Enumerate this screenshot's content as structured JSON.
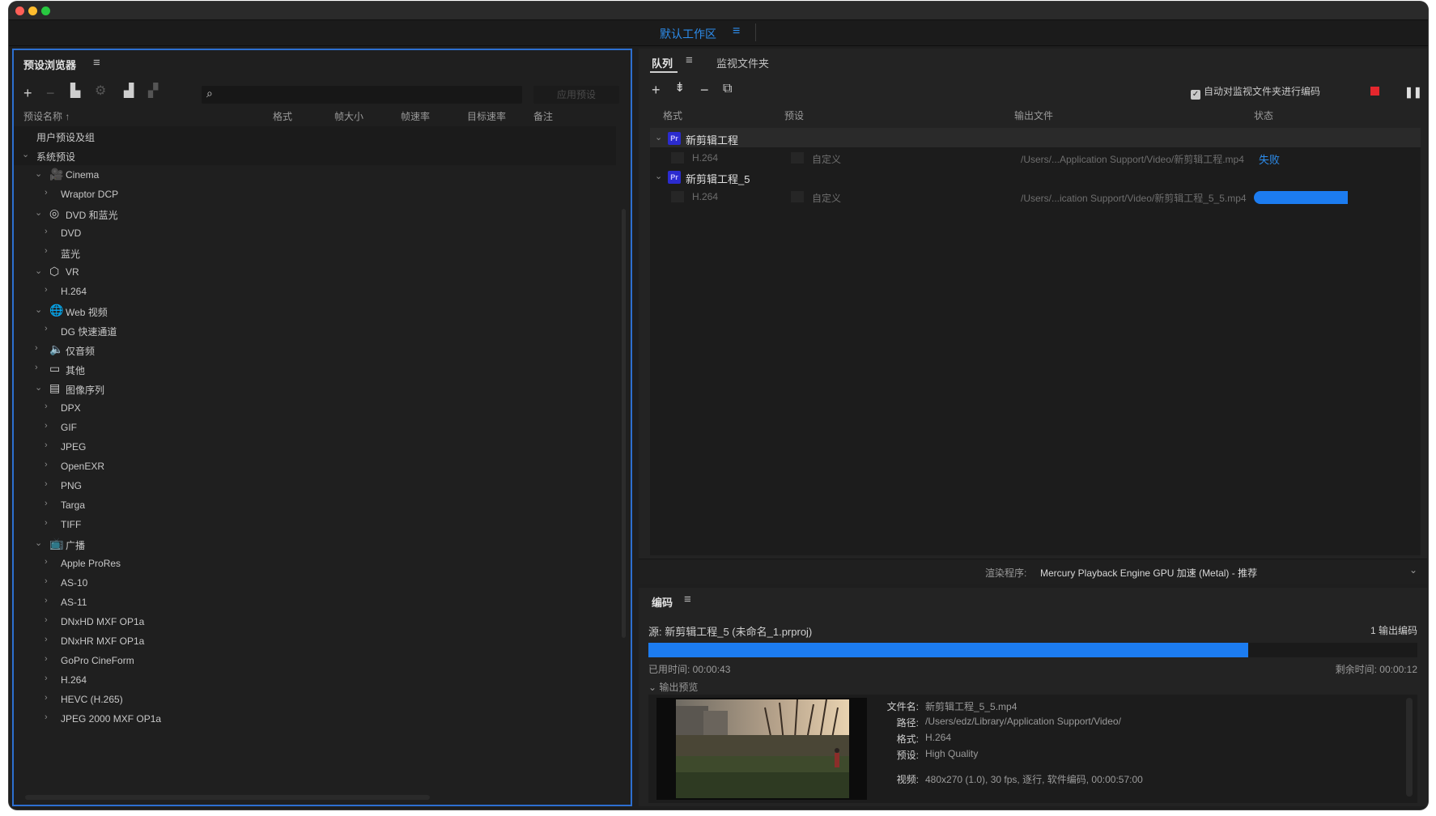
{
  "workspace": {
    "tab_label": "默认工作区",
    "menu_icon": "hamburger-icon"
  },
  "preset_browser": {
    "title": "预设浏览器",
    "menu_icon": "hamburger-icon",
    "toolbar": {
      "add": "+",
      "remove": "−",
      "apply_button": "应用预设",
      "search_placeholder": ""
    },
    "columns": [
      "预设名称 ↑",
      "格式",
      "帧大小",
      "帧速率",
      "目标速率",
      "备注"
    ],
    "tree": [
      {
        "label": "用户预设及组",
        "level": 0,
        "chev": "",
        "icon": ""
      },
      {
        "label": "系统预设",
        "level": 0,
        "chev": "⌄",
        "icon": ""
      },
      {
        "label": "Cinema",
        "level": 1,
        "chev": "⌄",
        "icon": "🎥"
      },
      {
        "label": "Wraptor DCP",
        "level": 2,
        "chev": "›",
        "icon": ""
      },
      {
        "label": "DVD 和蓝光",
        "level": 1,
        "chev": "⌄",
        "icon": "◎"
      },
      {
        "label": "DVD",
        "level": 2,
        "chev": "›",
        "icon": ""
      },
      {
        "label": "蓝光",
        "level": 2,
        "chev": "›",
        "icon": ""
      },
      {
        "label": "VR",
        "level": 1,
        "chev": "⌄",
        "icon": "⬡"
      },
      {
        "label": "H.264",
        "level": 2,
        "chev": "›",
        "icon": ""
      },
      {
        "label": "Web 视频",
        "level": 1,
        "chev": "⌄",
        "icon": "🌐"
      },
      {
        "label": "DG 快速通道",
        "level": 2,
        "chev": "›",
        "icon": ""
      },
      {
        "label": "仅音频",
        "level": 1,
        "chev": "›",
        "icon": "🔈"
      },
      {
        "label": "其他",
        "level": 1,
        "chev": "›",
        "icon": "▭"
      },
      {
        "label": "图像序列",
        "level": 1,
        "chev": "⌄",
        "icon": "▤"
      },
      {
        "label": "DPX",
        "level": 2,
        "chev": "›",
        "icon": ""
      },
      {
        "label": "GIF",
        "level": 2,
        "chev": "›",
        "icon": ""
      },
      {
        "label": "JPEG",
        "level": 2,
        "chev": "›",
        "icon": ""
      },
      {
        "label": "OpenEXR",
        "level": 2,
        "chev": "›",
        "icon": ""
      },
      {
        "label": "PNG",
        "level": 2,
        "chev": "›",
        "icon": ""
      },
      {
        "label": "Targa",
        "level": 2,
        "chev": "›",
        "icon": ""
      },
      {
        "label": "TIFF",
        "level": 2,
        "chev": "›",
        "icon": ""
      },
      {
        "label": "广播",
        "level": 1,
        "chev": "⌄",
        "icon": "📺"
      },
      {
        "label": "Apple ProRes",
        "level": 2,
        "chev": "›",
        "icon": ""
      },
      {
        "label": "AS-10",
        "level": 2,
        "chev": "›",
        "icon": ""
      },
      {
        "label": "AS-11",
        "level": 2,
        "chev": "›",
        "icon": ""
      },
      {
        "label": "DNxHD MXF OP1a",
        "level": 2,
        "chev": "›",
        "icon": ""
      },
      {
        "label": "DNxHR MXF OP1a",
        "level": 2,
        "chev": "›",
        "icon": ""
      },
      {
        "label": "GoPro CineForm",
        "level": 2,
        "chev": "›",
        "icon": ""
      },
      {
        "label": "H.264",
        "level": 2,
        "chev": "›",
        "icon": ""
      },
      {
        "label": "HEVC (H.265)",
        "level": 2,
        "chev": "›",
        "icon": ""
      },
      {
        "label": "JPEG 2000 MXF OP1a",
        "level": 2,
        "chev": "›",
        "icon": ""
      }
    ]
  },
  "queue": {
    "tab_queue": "队列",
    "tab_watch": "监视文件夹",
    "auto_encode_label": "自动对监视文件夹进行编码",
    "columns": {
      "format": "格式",
      "preset": "预设",
      "output": "输出文件",
      "status": "状态"
    },
    "items": [
      {
        "name": "新剪辑工程",
        "format": "H.264",
        "preset": "自定义",
        "output": "/Users/...Application Support/Video/新剪辑工程.mp4",
        "status": "失败"
      },
      {
        "name": "新剪辑工程_5",
        "format": "H.264",
        "preset": "自定义",
        "output": "/Users/...ication Support/Video/新剪辑工程_5_5.mp4",
        "status": ""
      }
    ],
    "renderer_label": "渲染程序:",
    "renderer_value": "Mercury Playback Engine GPU 加速 (Metal) - 推荐"
  },
  "encoding": {
    "title": "编码",
    "source": "源: 新剪辑工程_5 (未命名_1.prproj)",
    "output_count": "1 输出编码",
    "progress": 0.78,
    "elapsed": "已用时间: 00:00:43",
    "remaining": "剩余时间: 00:00:12",
    "preview_header": "输出预览",
    "meta": [
      {
        "k": "文件名:",
        "v": "新剪辑工程_5_5.mp4"
      },
      {
        "k": "路径:",
        "v": "/Users/edz/Library/Application Support/Video/"
      },
      {
        "k": "格式:",
        "v": "H.264"
      },
      {
        "k": "预设:",
        "v": "High Quality"
      },
      {
        "k": "视频:",
        "v": "480x270 (1.0), 30 fps, 逐行, 软件编码, 00:00:57:00"
      }
    ]
  },
  "colors": {
    "accent": "#2d8ceb",
    "progress": "#1c7cf0",
    "stop": "#e5272d",
    "panel_focus": "#2d6fd0"
  }
}
